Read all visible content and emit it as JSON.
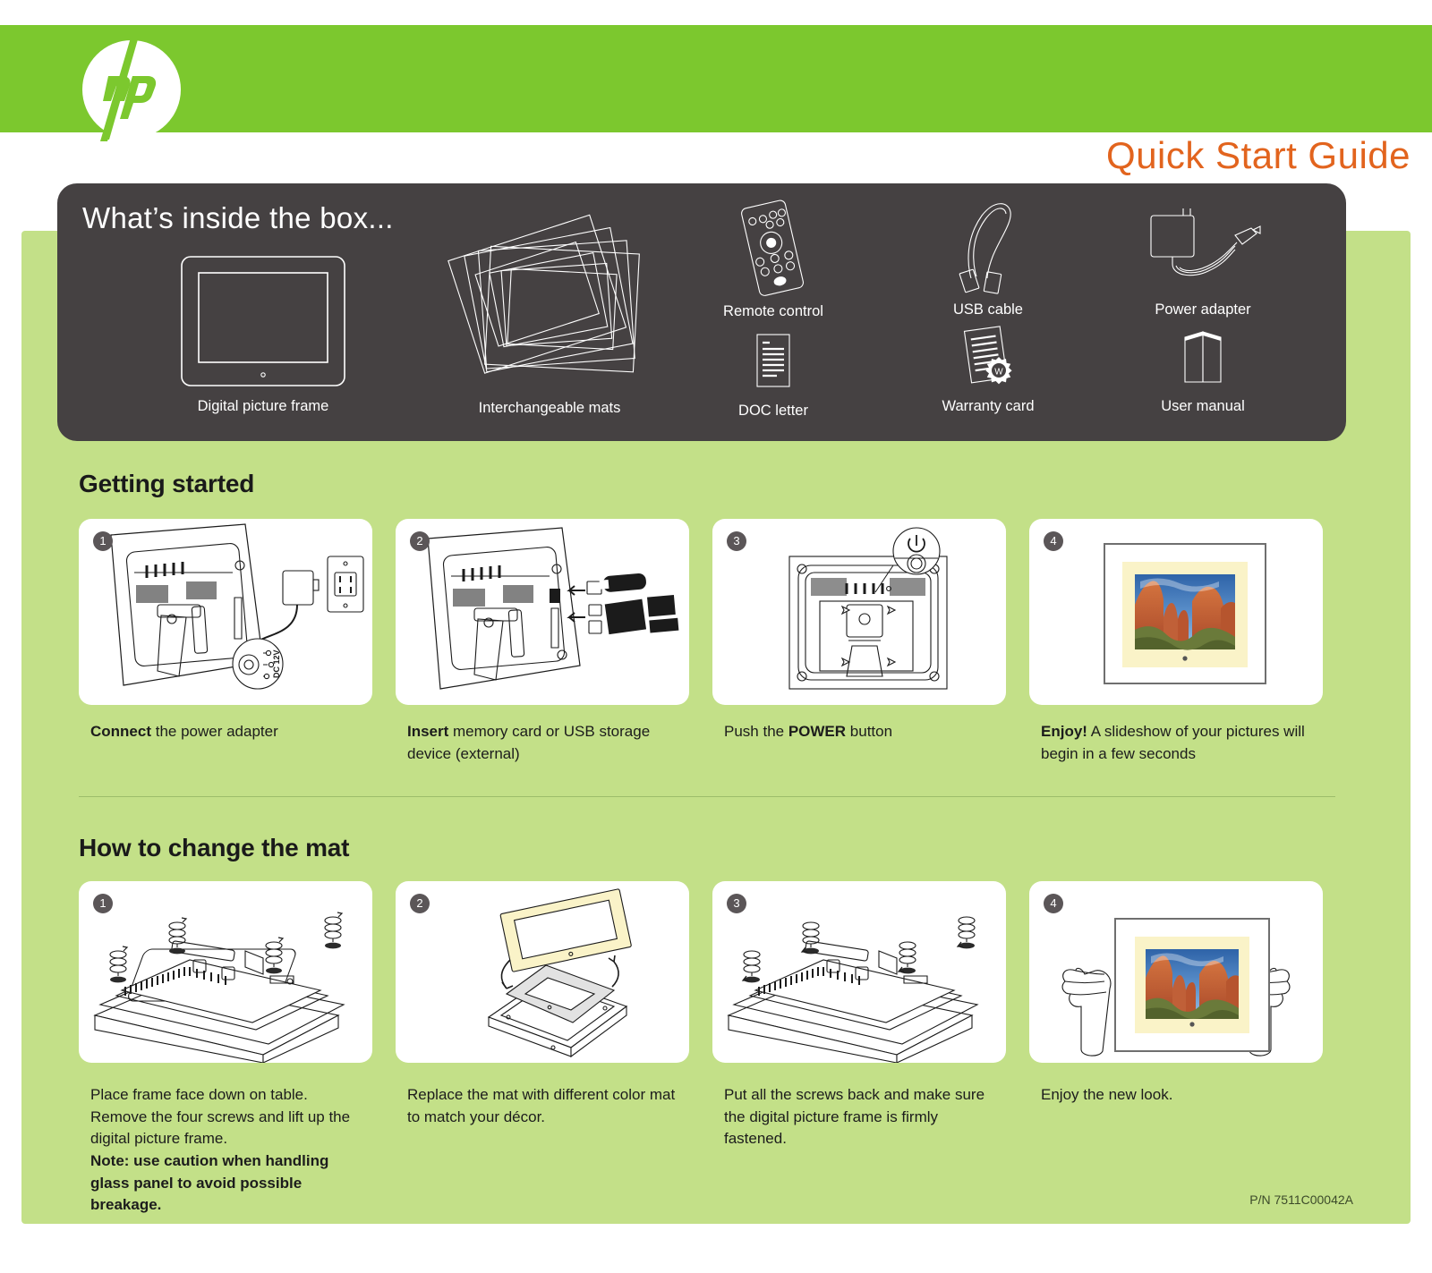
{
  "header": {
    "logo_name": "hp-logo",
    "brand": "hp",
    "title": "Quick Start Guide",
    "bar_color": "#7cc82e",
    "title_color": "#e2641e"
  },
  "box_contents": {
    "title": "What’s inside the box...",
    "panel_color": "#454142",
    "items": [
      {
        "icon": "digital-picture-frame-icon",
        "label": "Digital picture frame"
      },
      {
        "icon": "interchangeable-mats-icon",
        "label": "Interchangeable mats"
      },
      {
        "icon": "remote-control-icon",
        "label": "Remote control"
      },
      {
        "icon": "usb-cable-icon",
        "label": "USB cable"
      },
      {
        "icon": "power-adapter-icon",
        "label": "Power adapter"
      },
      {
        "icon": "doc-letter-icon",
        "label": "DOC letter"
      },
      {
        "icon": "warranty-card-icon",
        "label": "Warranty card"
      },
      {
        "icon": "user-manual-icon",
        "label": "User manual"
      }
    ]
  },
  "getting_started": {
    "heading": "Getting started",
    "steps": [
      {
        "number": "1",
        "caption_bold": "Connect",
        "caption_rest": " the power adapter",
        "art_label": "DC 12V"
      },
      {
        "number": "2",
        "caption_bold": "Insert",
        "caption_rest": " memory card or USB storage device (external)",
        "art_label": ""
      },
      {
        "number": "3",
        "caption_pre": "Push the ",
        "caption_bold": "POWER",
        "caption_rest": " button",
        "art_label": ""
      },
      {
        "number": "4",
        "caption_bold": "Enjoy!",
        "caption_rest": " A slideshow of your pictures will begin in a few seconds",
        "art_label": ""
      }
    ]
  },
  "change_mat": {
    "heading": "How to change the mat",
    "steps": [
      {
        "number": "1",
        "caption": "Place frame face down on table. Remove the four screws and lift up the digital picture frame.",
        "note": "Note:  use caution when handling glass panel to avoid possible breakage."
      },
      {
        "number": "2",
        "caption": "Replace the mat with different color mat to match your décor.",
        "note": ""
      },
      {
        "number": "3",
        "caption": "Put all the screws back and make sure the digital picture frame is firmly fastened.",
        "note": ""
      },
      {
        "number": "4",
        "caption": "Enjoy the new look.",
        "note": ""
      }
    ]
  },
  "footer": {
    "part_number": "P/N 7511C00042A"
  },
  "colors": {
    "hp_green": "#7cc82e",
    "panel_green": "#c3e088",
    "dark_gray": "#454142",
    "orange": "#e2641e",
    "mat_cream": "#faf3c8",
    "mat_gray": "#e2e2e2"
  }
}
